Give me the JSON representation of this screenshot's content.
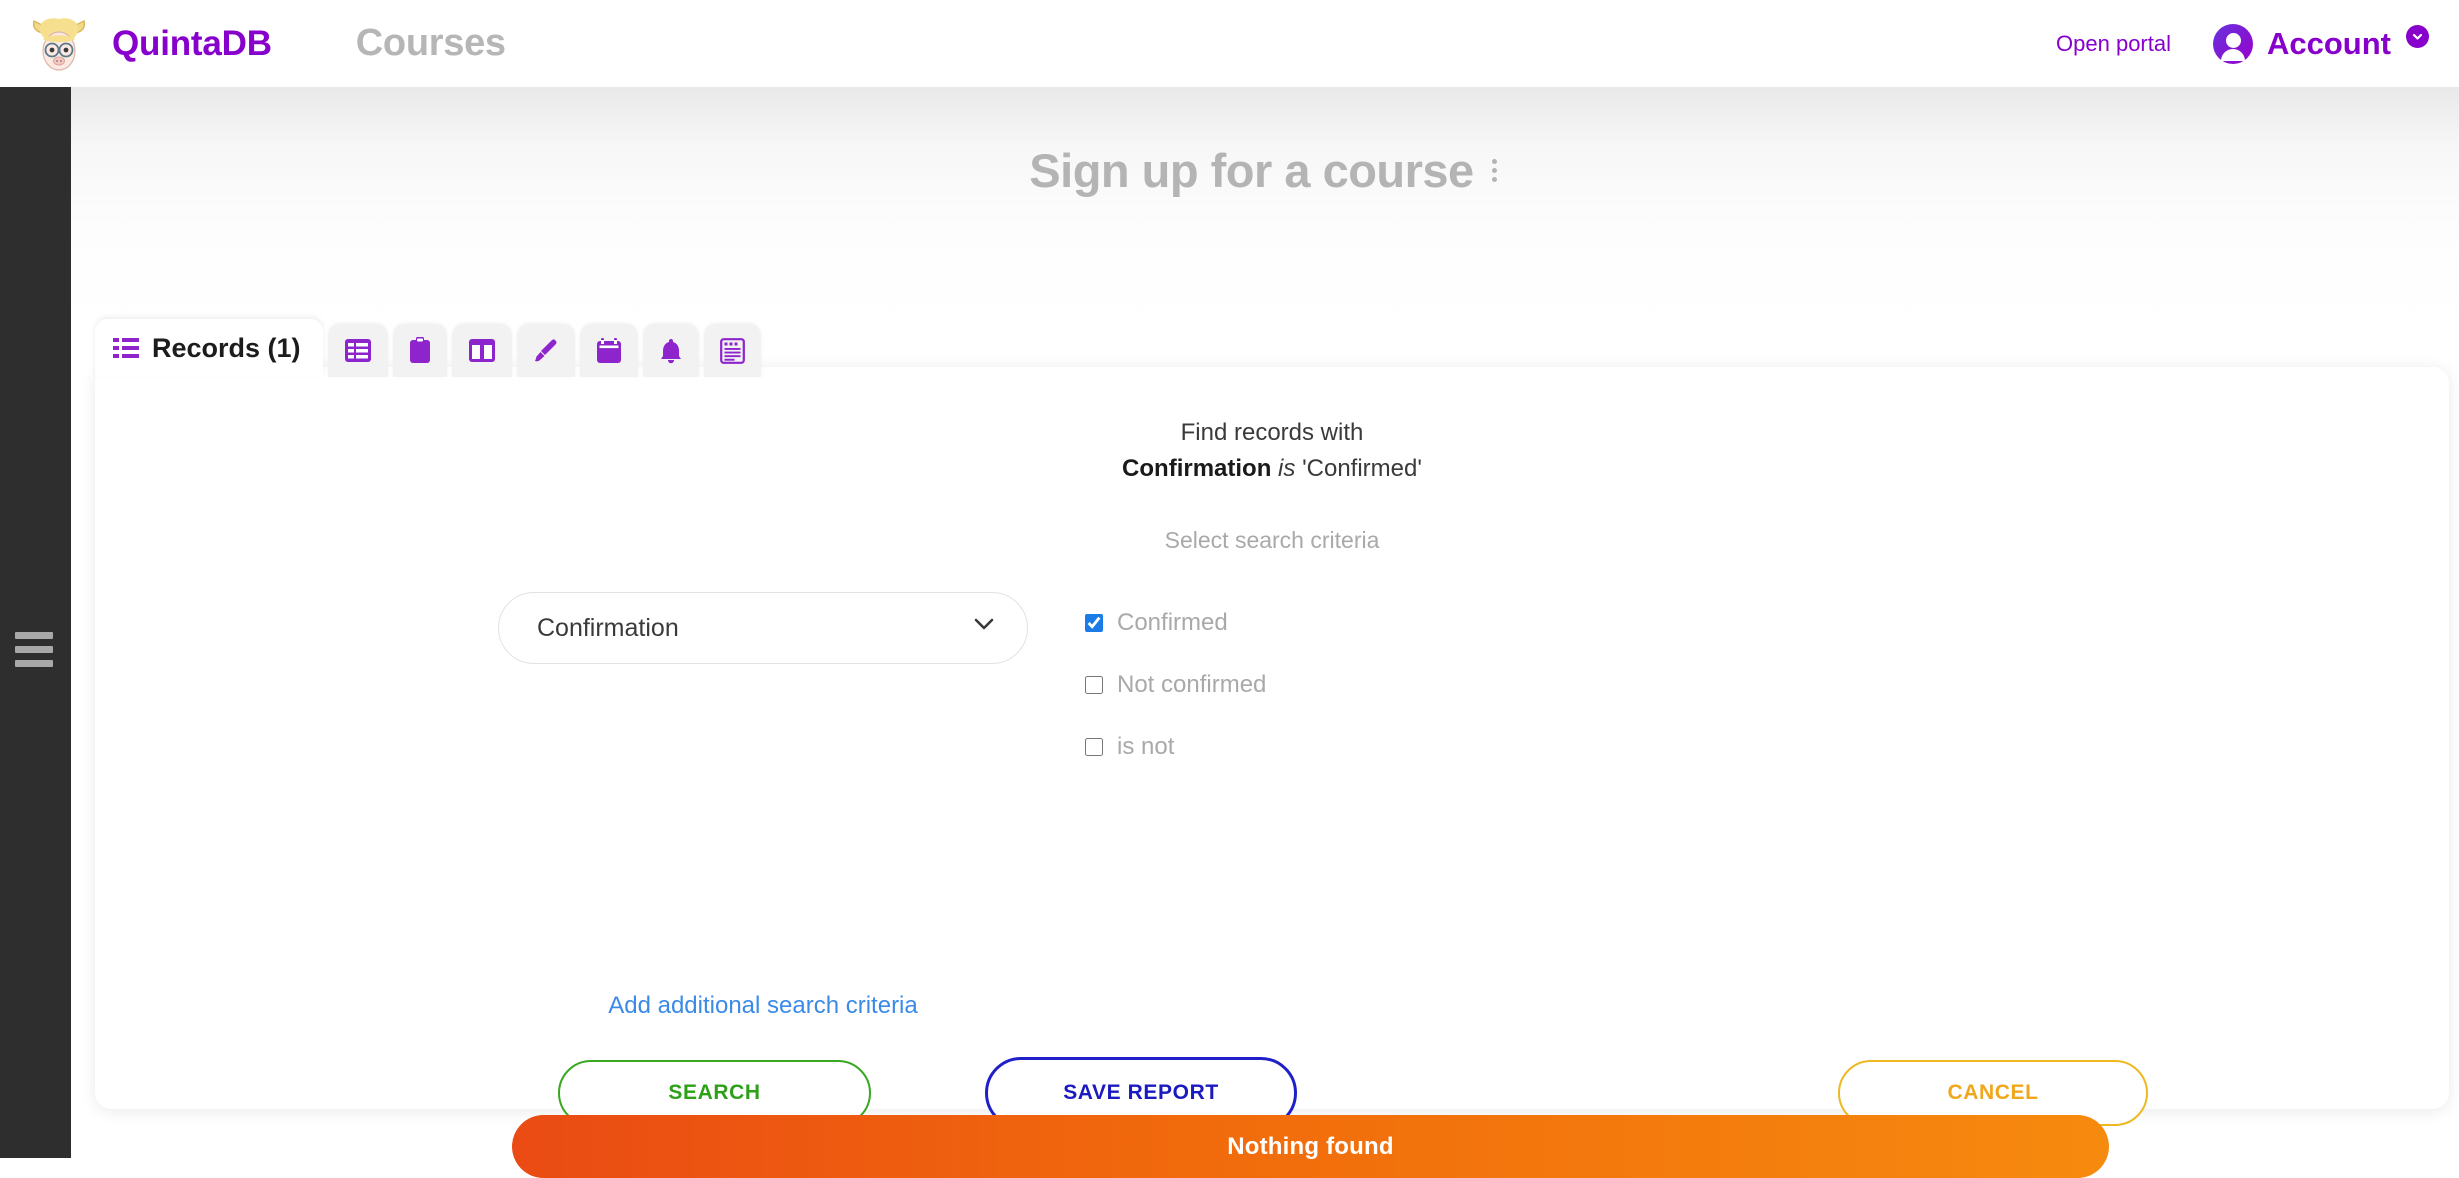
{
  "header": {
    "logo_icon": "quintadb-cow-logo",
    "brand": "QuintaDB",
    "section": "Courses",
    "open_portal_label": "Open portal",
    "account_label": "Account",
    "account_icon": "user-avatar-icon",
    "account_caret_icon": "chevron-down-circle-icon"
  },
  "sidebar": {
    "menu_icon": "hamburger-menu-icon"
  },
  "page": {
    "title": "Sign up for a course",
    "title_menu_icon": "kebab-menu-icon"
  },
  "tabs": [
    {
      "label": "Records (1)",
      "icon": "list-records-icon",
      "active": true
    },
    {
      "label": "",
      "icon": "table-view-icon",
      "active": false
    },
    {
      "label": "",
      "icon": "clipboard-form-icon",
      "active": false
    },
    {
      "label": "",
      "icon": "columns-layout-icon",
      "active": false
    },
    {
      "label": "",
      "icon": "paintbrush-design-icon",
      "active": false
    },
    {
      "label": "",
      "icon": "calendar-icon",
      "active": false
    },
    {
      "label": "",
      "icon": "bell-notifications-icon",
      "active": false
    },
    {
      "label": "",
      "icon": "report-document-icon",
      "active": false
    }
  ],
  "search_panel": {
    "find_prefix": "Find records with",
    "criteria_field": "Confirmation",
    "criteria_operator": "is",
    "criteria_value": "'Confirmed'",
    "select_hint": "Select search criteria",
    "field_select_value": "Confirmation",
    "select_chevron_icon": "chevron-down-icon",
    "add_criteria_label": "Add additional search criteria",
    "options": [
      {
        "label": "Confirmed",
        "checked": true
      },
      {
        "label": "Not confirmed",
        "checked": false
      },
      {
        "label": "is not",
        "checked": false
      }
    ],
    "buttons": {
      "search": "SEARCH",
      "save_report": "SAVE REPORT",
      "cancel": "CANCEL"
    }
  },
  "status_banner": {
    "text": "Nothing found"
  },
  "colors": {
    "brand_purple": "#8800cc",
    "search_green": "#2ea018",
    "save_blue": "#1a1ac0",
    "cancel_yellow": "#efa81e",
    "banner_orange_start": "#ea4b14",
    "banner_orange_end": "#f68a0e",
    "link_blue": "#3b8ae8",
    "sidebar_dark": "#2e2e2e"
  }
}
